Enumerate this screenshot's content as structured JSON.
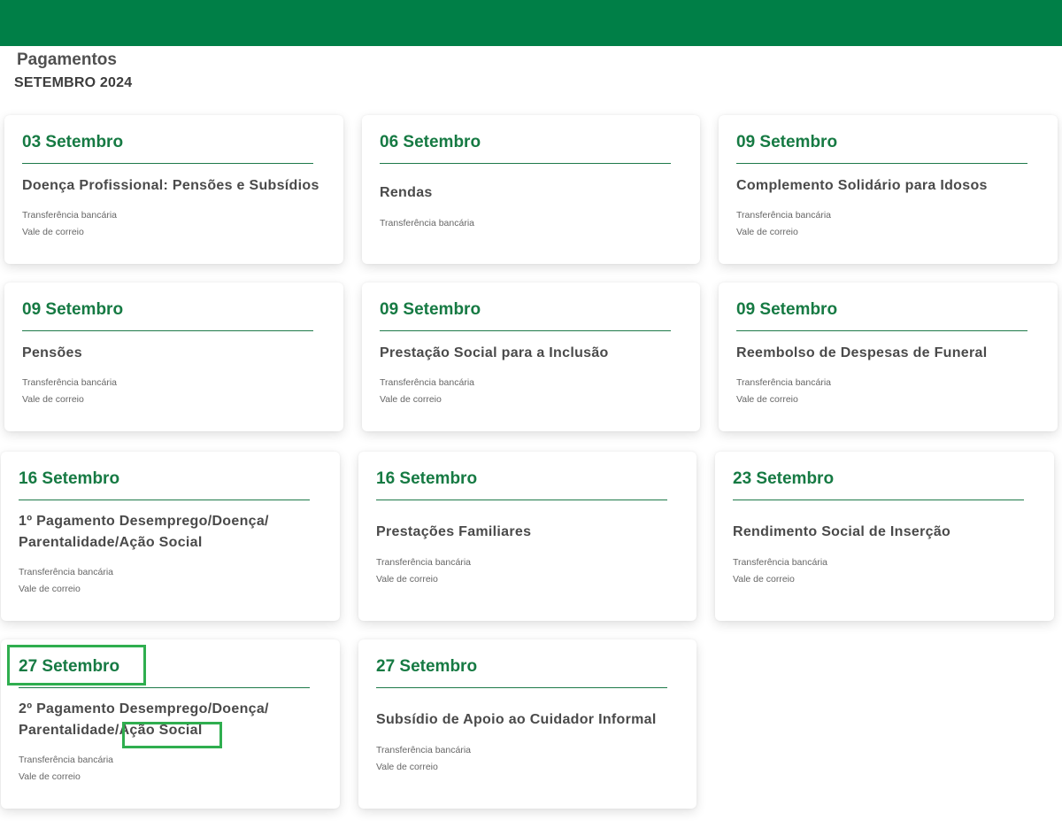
{
  "header": {
    "title": "Pagamentos",
    "subtitle": "SETEMBRO 2024",
    "bar_color": "#007f47"
  },
  "colors": {
    "accent": "#167a43",
    "highlight": "#2fae4f"
  },
  "cards": [
    {
      "date": "03 Setembro",
      "name_lines": [
        "Doença Profissional: Pensões e Subsídios"
      ],
      "methods": [
        "Transferência bancária",
        "Vale de correio"
      ]
    },
    {
      "date": "06 Setembro",
      "name_lines": [
        "Rendas"
      ],
      "methods": [
        "Transferência bancária"
      ]
    },
    {
      "date": "09 Setembro",
      "name_lines": [
        "Complemento Solidário para Idosos"
      ],
      "methods": [
        "Transferência bancária",
        "Vale de correio"
      ]
    },
    {
      "date": "09 Setembro",
      "name_lines": [
        "Pensões"
      ],
      "methods": [
        "Transferência bancária",
        "Vale de correio"
      ]
    },
    {
      "date": "09 Setembro",
      "name_lines": [
        "Prestação Social para a Inclusão"
      ],
      "methods": [
        "Transferência bancária",
        "Vale de correio"
      ]
    },
    {
      "date": "09 Setembro",
      "name_lines": [
        "Reembolso de Despesas de Funeral"
      ],
      "methods": [
        "Transferência bancária",
        "Vale de correio"
      ]
    },
    {
      "date": "16 Setembro",
      "name_lines": [
        "1º Pagamento Desemprego/Doença/",
        "Parentalidade/Ação Social"
      ],
      "methods": [
        "Transferência bancária",
        "Vale de correio"
      ]
    },
    {
      "date": "16 Setembro",
      "name_lines": [
        "Prestações Familiares"
      ],
      "methods": [
        "Transferência bancária",
        "Vale de correio"
      ]
    },
    {
      "date": "23 Setembro",
      "name_lines": [
        "Rendimento Social de Inserção"
      ],
      "methods": [
        "Transferência bancária",
        "Vale de correio"
      ]
    },
    {
      "date": "27 Setembro",
      "name_lines": [
        "2º Pagamento Desemprego/Doença/",
        "Parentalidade/Ação Social"
      ],
      "methods": [
        "Transferência bancária",
        "Vale de correio"
      ]
    },
    {
      "date": "27 Setembro",
      "name_lines": [
        "Subsídio de Apoio ao Cuidador Informal"
      ],
      "methods": [
        "Transferência bancária",
        "Vale de correio"
      ]
    }
  ]
}
